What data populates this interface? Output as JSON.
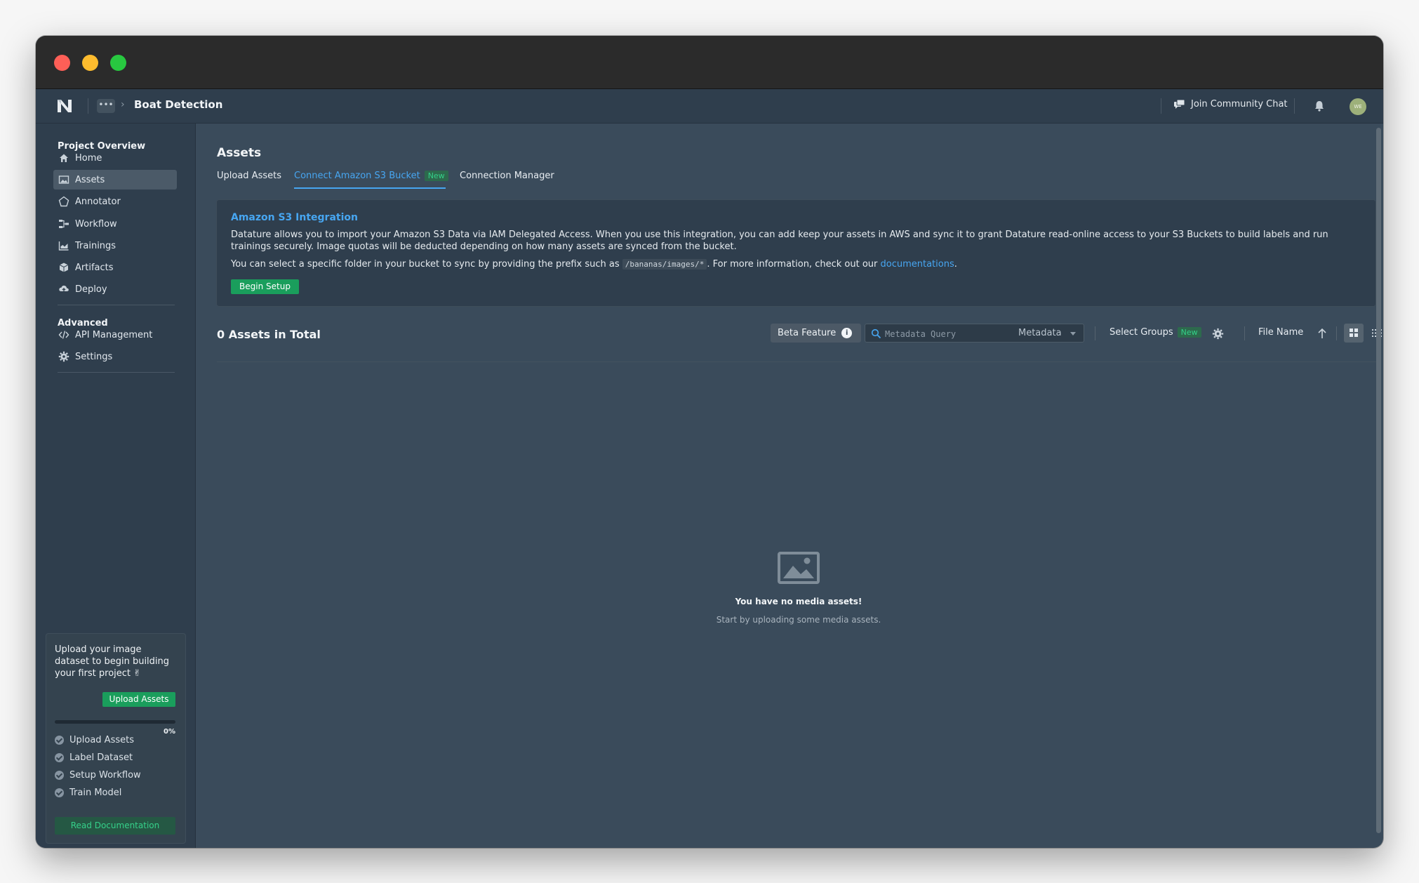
{
  "topbar": {
    "more_label": "•••",
    "project_title": "Boat Detection",
    "join_chat": "Join Community Chat",
    "avatar_initials": "WE"
  },
  "sidebar": {
    "section_overview": "Project Overview",
    "items": [
      {
        "label": "Home",
        "icon": "home-icon"
      },
      {
        "label": "Assets",
        "icon": "image-icon",
        "active": true
      },
      {
        "label": "Annotator",
        "icon": "annotator-icon"
      },
      {
        "label": "Workflow",
        "icon": "workflow-icon"
      },
      {
        "label": "Trainings",
        "icon": "chart-icon"
      },
      {
        "label": "Artifacts",
        "icon": "cube-icon"
      },
      {
        "label": "Deploy",
        "icon": "deploy-icon"
      }
    ],
    "section_advanced": "Advanced",
    "advanced_items": [
      {
        "label": "API Management",
        "icon": "code-icon"
      },
      {
        "label": "Settings",
        "icon": "gear-icon"
      }
    ]
  },
  "onboarding": {
    "text": "Upload your image dataset to begin building your first project ✌",
    "upload_button": "Upload Assets",
    "progress_percent": 0,
    "progress_label": "0%",
    "steps": [
      "Upload Assets",
      "Label Dataset",
      "Setup Workflow",
      "Train Model"
    ],
    "docs_button": "Read Documentation"
  },
  "main": {
    "title": "Assets",
    "tabs": [
      {
        "label": "Upload Assets"
      },
      {
        "label": "Connect Amazon S3 Bucket",
        "badge": "New",
        "active": true
      },
      {
        "label": "Connection Manager"
      }
    ]
  },
  "s3": {
    "title": "Amazon S3 Integration",
    "description": "Datature allows you to import your Amazon S3 Data via IAM Delegated Access. When you use this integration, you can add keep your assets in AWS and sync it to grant Datature read-online access to your S3 Buckets to build labels and run trainings securely. Image quotas will be deducted depending on how many assets are synced from the bucket.",
    "line2_before": "You can select a specific folder in your bucket to sync by providing the prefix such as",
    "prefix_example": "/bananas/images/*",
    "line2_after": ". For more information, check out our",
    "link_text": "documentations",
    "line2_end": ".",
    "begin_button": "Begin Setup"
  },
  "toolbar": {
    "count_label": "0 Assets in Total",
    "beta_label": "Beta Feature",
    "info_glyph": "i",
    "query_placeholder": "Metadata Query",
    "metadata_select": "Metadata",
    "select_groups": "Select Groups",
    "select_groups_badge": "New",
    "sort_field": "File Name",
    "view_mode": "grid"
  },
  "empty": {
    "title": "You have no media assets!",
    "subtitle": "Start by uploading some media assets."
  },
  "colors": {
    "accent_blue": "#47a6f1",
    "accent_green": "#1a9e5c",
    "background": "#3a4b5b",
    "sidebar": "#2f3e4d"
  }
}
